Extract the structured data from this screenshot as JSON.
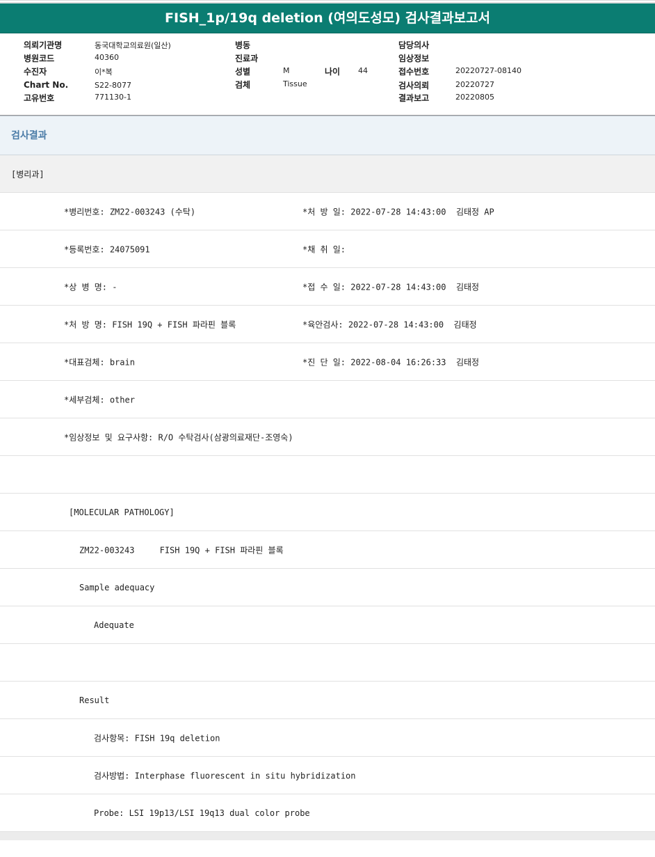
{
  "title": "FISH_1p/19q deletion (여의도성모) 검사결과보고서",
  "header": {
    "institution_label": "의뢰기관명",
    "institution": "동국대학교의료원(일산)",
    "hospital_code_label": "병원코드",
    "hospital_code": "40360",
    "patient_label": "수진자",
    "patient": "이*복",
    "chart_label": "Chart No.",
    "chart_no": "S22-8077",
    "unique_label": "고유번호",
    "unique_no": "771130-1",
    "ward_label": "병동",
    "dept_label": "진료과",
    "sex_label": "성별",
    "sex": "M",
    "age_label": "나이",
    "age": "44",
    "specimen_label": "검체",
    "specimen": "Tissue",
    "doctor_label": "담당의사",
    "clinical_label": "임상정보",
    "receipt_label": "접수번호",
    "receipt_no": "20220727-08140",
    "request_label": "검사의뢰",
    "request_date": "20220727",
    "report_label": "결과보고",
    "report_date": "20220805"
  },
  "section_title": "검사결과",
  "rows": [
    {
      "left": "[병리과]",
      "right": ""
    },
    {
      "left": "*병리번호: ZM22-003243 (수탁)",
      "right": "*처 방 일: 2022-07-28 14:43:00  김태정 AP"
    },
    {
      "left": "*등록번호: 24075091",
      "right": "*채 취 일:"
    },
    {
      "left": "*상 병 명: -",
      "right": "*접 수 일: 2022-07-28 14:43:00  김태정"
    },
    {
      "left": "*처 방 명: FISH 19Q + FISH 파라핀 블록",
      "right": "*육안검사: 2022-07-28 14:43:00  김태정"
    },
    {
      "left": "*대표검체: brain",
      "right": "*진 단 일: 2022-08-04 16:26:33  김태정"
    },
    {
      "left": "*세부검체: other",
      "right": ""
    },
    {
      "left": "*임상정보 및 요구사항: R/O 수탁검사(삼광의료재단-조영숙)",
      "right": ""
    },
    {
      "left": "",
      "right": ""
    },
    {
      "left": "[MOLECULAR PATHOLOGY]",
      "right": ""
    },
    {
      "left": "ZM22-003243     FISH 19Q + FISH 파라핀 블록",
      "right": ""
    },
    {
      "left": "Sample adequacy",
      "right": ""
    },
    {
      "left": "Adequate",
      "right": ""
    },
    {
      "left": "",
      "right": ""
    },
    {
      "left": "Result",
      "right": ""
    },
    {
      "left": "검사항목: FISH 19q deletion",
      "right": ""
    },
    {
      "left": "검사방법: Interphase fluorescent in situ hybridization",
      "right": ""
    },
    {
      "left": "Probe: LSI 19p13/LSI 19q13 dual color probe",
      "right": ""
    }
  ]
}
